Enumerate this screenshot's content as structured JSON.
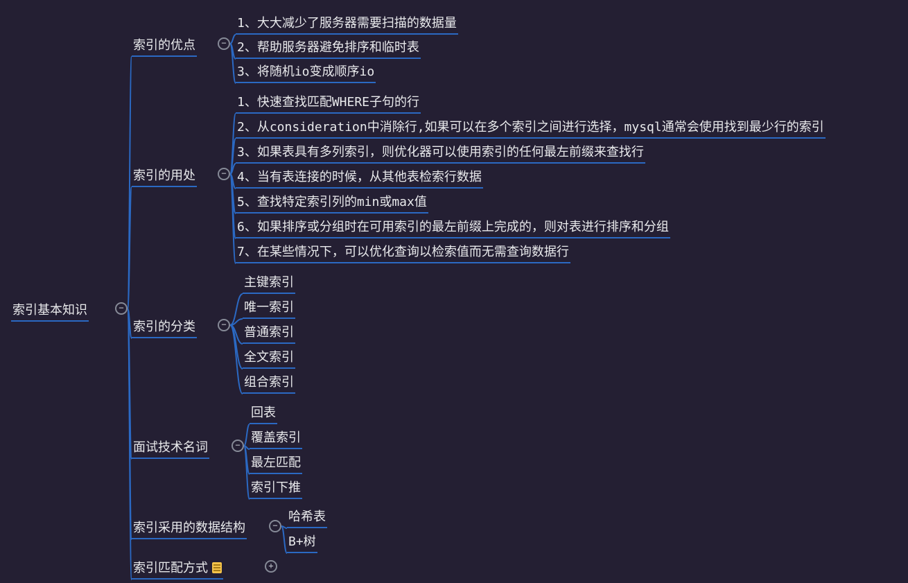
{
  "colors": {
    "line": "#2b69c3",
    "bg": "#241f33",
    "text": "#e9eaec",
    "toggle": "#868a97"
  },
  "root": {
    "label": "索引基本知识"
  },
  "branches": [
    {
      "label": "索引的优点",
      "toggle": "−",
      "children": [
        "1、大大减少了服务器需要扫描的数据量",
        "2、帮助服务器避免排序和临时表",
        "3、将随机io变成顺序io"
      ]
    },
    {
      "label": "索引的用处",
      "toggle": "−",
      "children": [
        "1、快速查找匹配WHERE子句的行",
        "2、从consideration中消除行,如果可以在多个索引之间进行选择，mysql通常会使用找到最少行的索引",
        "3、如果表具有多列索引，则优化器可以使用索引的任何最左前缀来查找行",
        "4、当有表连接的时候，从其他表检索行数据",
        "5、查找特定索引列的min或max值",
        "6、如果排序或分组时在可用索引的最左前缀上完成的，则对表进行排序和分组",
        "7、在某些情况下，可以优化查询以检索值而无需查询数据行"
      ]
    },
    {
      "label": "索引的分类",
      "toggle": "−",
      "children": [
        "主键索引",
        "唯一索引",
        "普通索引",
        "全文索引",
        "组合索引"
      ]
    },
    {
      "label": "面试技术名词",
      "toggle": "−",
      "children": [
        "回表",
        "覆盖索引",
        "最左匹配",
        "索引下推"
      ]
    },
    {
      "label": "索引采用的数据结构",
      "toggle": "−",
      "children": [
        "哈希表",
        "B+树"
      ]
    },
    {
      "label": "索引匹配方式",
      "toggle": "+",
      "note": true,
      "children": []
    }
  ]
}
